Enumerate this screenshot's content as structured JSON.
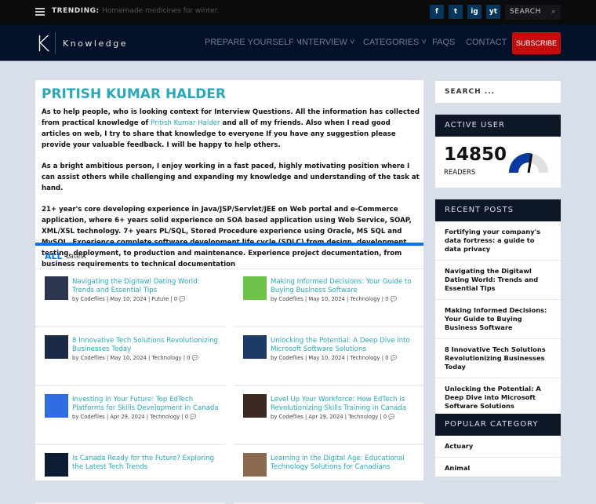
{
  "topbar": {
    "trending_label": "TRENDING:",
    "trending_text": "Homemade medicines for winter.",
    "social": [
      "f",
      "t",
      "ig",
      "yt"
    ],
    "search_label": "SEARCH"
  },
  "nav": {
    "logo_letter": "K",
    "logo_text": "Knowledge",
    "items": [
      "PREPARE YOURSELF",
      "INTERVIEW",
      "CATEGORIES",
      "FAQS",
      "CONTACT"
    ],
    "subscribe": "SUBSCRIBE"
  },
  "main": {
    "title": "PRITISH KUMAR HALDER",
    "intro_p1_a": "As to help people, who is looking context for Interview Questions. All the information has collected from practical knowledge of ",
    "intro_p1_link": "Pritish Kumar Halder",
    "intro_p1_b": " and all of my friends. Also when I read good articles on web, I try to share that knowledge to everyone If you have any suggestion please provide your valuable feedback. I will be happy to help others.",
    "intro_p2": "As a bright ambitious person, I enjoy working in a fast paced, highly motivating position where I can assist others while challenging and expanding my knowledge and understanding of the task at hand.",
    "intro_p3": "21+ year's core developing experience in Java/JSP/Servlet/JEE on Web portal and e-Commerce application, where 6+ years solid experience on SOA based application using Web Service, SOAP, XML/XSL technology. 7+ years PL/SQL, Stored Procedure experience using Oracle, MS SQL and MySQL. Experience complete software development life cycle (SDLC) from design, development, testing, deployment, to production and maintenance. Experience project documentation, from business requirements to technical documentation",
    "tab_all": "ALL",
    "tab_latest": "Latest",
    "posts": [
      {
        "title": "Navigating the Digitawl Dating World: Trends and Essential Tips",
        "meta": "by Codeflies | May 10, 2024 | Future | 0 💬"
      },
      {
        "title": "Making Informed Decisions: Your Guide to Buying Business Software",
        "meta": "by Codeflies | May 10, 2024 | Technology | 0 💬"
      },
      {
        "title": "8 Innovative Tech Solutions Revolutionizing Businesses Today",
        "meta": "by Codeflies | May 10, 2024 | Technology | 0 💬"
      },
      {
        "title": "Unlocking the Potential: A Deep Dive into Microsoft Software Solutions",
        "meta": "by Codeflies | May 10, 2024 | Technology | 0 💬"
      },
      {
        "title": "Investing in Your Future: Top EdTech Platforms for Skills Development in Canada",
        "meta": "by Codeflies | Apr 29, 2024 | Technology | 0 💬"
      },
      {
        "title": "Level Up Your Workforce: How EdTech is Revolutionizing Skills Training in Canada",
        "meta": "by Codeflies | Apr 29, 2024 | Technology | 0 💬"
      },
      {
        "title": "Is Canada Ready for the Future? Exploring the Latest Tech Trends",
        "meta": ""
      },
      {
        "title": "Learning in the Digital Age: Educational Technology Solutions for Canadians",
        "meta": ""
      }
    ]
  },
  "sidebar": {
    "search_placeholder": "SEARCH ...",
    "active_user_title": "ACTIVE USER",
    "readers_count": "14850",
    "readers_label": "READERS",
    "gauge_fraction": 0.55,
    "recent_title": "RECENT POSTS",
    "recent": [
      "Fortifying your company's data fortress: a guide to data privacy",
      "Navigating the Digitawl Dating World: Trends and Essential Tips",
      "Making Informed Decisions: Your Guide to Buying Business Software",
      "8 Innovative Tech Solutions Revolutionizing Businesses Today",
      "Unlocking the Potential: A Deep Dive into Microsoft Software Solutions"
    ],
    "popular_title": "POPULAR CATEGORY",
    "popular": [
      "Actuary",
      "Animal"
    ]
  },
  "colors": {
    "accent": "#2ba8b8",
    "blue": "#0a74e6",
    "subscribe": "#c30d0d"
  }
}
